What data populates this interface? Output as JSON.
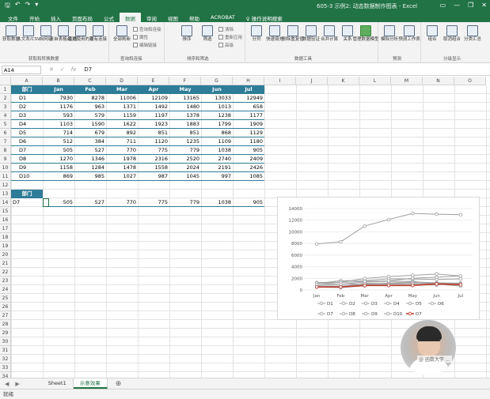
{
  "titlebar": {
    "title": "605-3 示例2: 动态数据制作图表   -   Excel",
    "quick_access": [
      "save-icon",
      "undo-icon",
      "redo-icon",
      "customize-icon"
    ],
    "controls": [
      "ribbon-display-icon",
      "minimize-icon",
      "restore-icon",
      "close-icon"
    ]
  },
  "tabs": [
    "文件",
    "开始",
    "插入",
    "页面布局",
    "公式",
    "数据",
    "审阅",
    "视图",
    "帮助",
    "ACROBAT",
    "♀ 操作说明搜索"
  ],
  "active_tab": "数据",
  "ribbon": {
    "groups": [
      {
        "name": "获取和转换数据",
        "buttons": [
          "获取数据",
          "从文本/CSV",
          "自网站",
          "来自表格/区域",
          "最近使用的源",
          "现有连接"
        ]
      },
      {
        "name": "查询和连接",
        "buttons": [
          "全部刷新"
        ],
        "small": [
          "查询和连接",
          "属性",
          "编辑链接"
        ]
      },
      {
        "name": "排序和筛选",
        "buttons": [
          "排序",
          "筛选"
        ],
        "small": [
          "清除",
          "重新应用",
          "高级"
        ]
      },
      {
        "name": "数据工具",
        "buttons": [
          "分列",
          "快速填充",
          "删除重复值",
          "数据验证",
          "合并计算",
          "关系",
          "管理数据模型"
        ]
      },
      {
        "name": "预测",
        "buttons": [
          "模拟分析",
          "预测工作表"
        ]
      },
      {
        "name": "分级显示",
        "buttons": [
          "组合",
          "取消组合",
          "分类汇总"
        ]
      }
    ]
  },
  "formula_bar": {
    "name_box": "A14",
    "formula": "D7"
  },
  "columns": [
    "A",
    "B",
    "C",
    "D",
    "E",
    "F",
    "G",
    "H",
    "I",
    "J",
    "K",
    "L",
    "M",
    "N",
    "O"
  ],
  "rows": [
    "1",
    "2",
    "3",
    "4",
    "5",
    "6",
    "7",
    "8",
    "9",
    "10",
    "11",
    "12",
    "13",
    "14",
    "15",
    "16",
    "17",
    "18",
    "19",
    "20",
    "21",
    "22",
    "23",
    "24",
    "25",
    "26",
    "27",
    "28",
    "29",
    "30",
    "31",
    "32",
    "33",
    "34"
  ],
  "table": {
    "headers": [
      "部门",
      "Jan",
      "Feb",
      "Mar",
      "Apr",
      "May",
      "Jun",
      "Jul"
    ],
    "rows": [
      [
        "D1",
        "7930",
        "8278",
        "11006",
        "12109",
        "13165",
        "13033",
        "12949"
      ],
      [
        "D2",
        "1176",
        "963",
        "1371",
        "1492",
        "1480",
        "1013",
        "658"
      ],
      [
        "D3",
        "593",
        "579",
        "1159",
        "1197",
        "1378",
        "1238",
        "1177"
      ],
      [
        "D4",
        "1103",
        "1590",
        "1622",
        "1923",
        "1883",
        "1799",
        "1909"
      ],
      [
        "D5",
        "714",
        "679",
        "892",
        "851",
        "851",
        "868",
        "1129"
      ],
      [
        "D6",
        "512",
        "384",
        "711",
        "1120",
        "1235",
        "1109",
        "1180"
      ],
      [
        "D7",
        "505",
        "527",
        "770",
        "775",
        "779",
        "1038",
        "905"
      ],
      [
        "D8",
        "1270",
        "1346",
        "1978",
        "2316",
        "2520",
        "2740",
        "2409"
      ],
      [
        "D9",
        "1158",
        "1284",
        "1478",
        "1558",
        "2024",
        "2191",
        "2426"
      ],
      [
        "D10",
        "869",
        "985",
        "1027",
        "987",
        "1045",
        "997",
        "1085"
      ]
    ]
  },
  "lookup": {
    "header": "部门",
    "row": [
      "D7",
      "505",
      "527",
      "770",
      "775",
      "779",
      "1038",
      "905"
    ]
  },
  "chart_data": {
    "type": "line",
    "categories": [
      "Jan",
      "Feb",
      "Mar",
      "Apr",
      "May",
      "Jun",
      "Jul"
    ],
    "ylim": [
      0,
      14000
    ],
    "yticks": [
      "0",
      "2000",
      "4000",
      "6000",
      "8000",
      "10000",
      "12000",
      "14000"
    ],
    "highlight_color": "#c0392b",
    "series_color": "#a0a0a0",
    "series": [
      {
        "name": "D1",
        "values": [
          7930,
          8278,
          11006,
          12109,
          13165,
          13033,
          12949
        ]
      },
      {
        "name": "D2",
        "values": [
          1176,
          963,
          1371,
          1492,
          1480,
          1013,
          658
        ]
      },
      {
        "name": "D3",
        "values": [
          593,
          579,
          1159,
          1197,
          1378,
          1238,
          1177
        ]
      },
      {
        "name": "D4",
        "values": [
          1103,
          1590,
          1622,
          1923,
          1883,
          1799,
          1909
        ]
      },
      {
        "name": "D5",
        "values": [
          714,
          679,
          892,
          851,
          851,
          868,
          1129
        ]
      },
      {
        "name": "D6",
        "values": [
          512,
          384,
          711,
          1120,
          1235,
          1109,
          1180
        ]
      },
      {
        "name": "D7",
        "values": [
          505,
          527,
          770,
          775,
          779,
          1038,
          905
        ]
      },
      {
        "name": "D8",
        "values": [
          1270,
          1346,
          1978,
          2316,
          2520,
          2740,
          2409
        ]
      },
      {
        "name": "D9",
        "values": [
          1158,
          1284,
          1478,
          1558,
          2024,
          2191,
          2426
        ]
      },
      {
        "name": "D10",
        "values": [
          869,
          985,
          1027,
          987,
          1045,
          997,
          1085
        ]
      },
      {
        "name": "D7",
        "values": [
          505,
          527,
          770,
          775,
          779,
          1038,
          905
        ],
        "highlight": true
      }
    ],
    "legend": "bottom"
  },
  "sheets": [
    "Sheet1",
    "示意效果"
  ],
  "active_sheet": "示意效果",
  "status": "就绪",
  "watermark": "@ 函数大学 ..."
}
